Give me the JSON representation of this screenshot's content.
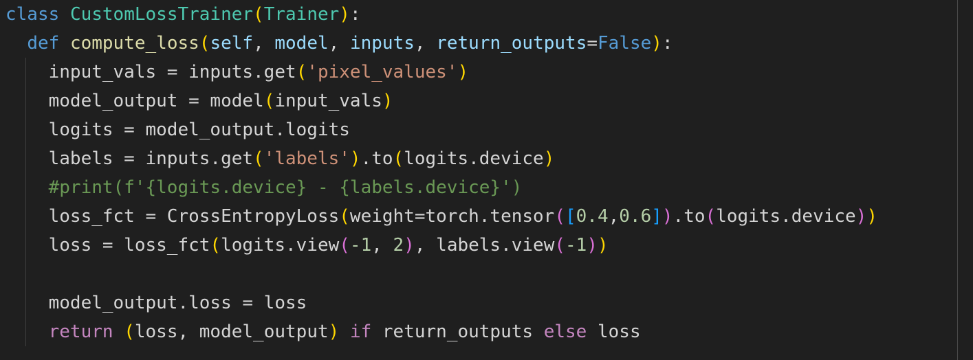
{
  "editor": {
    "lines": [
      [
        {
          "t": "class",
          "c": "kw"
        },
        {
          "t": " ",
          "c": "txt"
        },
        {
          "t": "CustomLossTrainer",
          "c": "cls"
        },
        {
          "t": "(",
          "c": "b1"
        },
        {
          "t": "Trainer",
          "c": "cls"
        },
        {
          "t": ")",
          "c": "b1"
        },
        {
          "t": ":",
          "c": "txt"
        }
      ],
      [
        {
          "t": "  ",
          "c": "txt"
        },
        {
          "t": "def",
          "c": "kw"
        },
        {
          "t": " ",
          "c": "txt"
        },
        {
          "t": "compute_loss",
          "c": "fn"
        },
        {
          "t": "(",
          "c": "b1"
        },
        {
          "t": "self",
          "c": "par"
        },
        {
          "t": ", ",
          "c": "txt"
        },
        {
          "t": "model",
          "c": "par"
        },
        {
          "t": ", ",
          "c": "txt"
        },
        {
          "t": "inputs",
          "c": "par"
        },
        {
          "t": ", ",
          "c": "txt"
        },
        {
          "t": "return_outputs",
          "c": "par"
        },
        {
          "t": "=",
          "c": "txt"
        },
        {
          "t": "False",
          "c": "kw"
        },
        {
          "t": ")",
          "c": "b1"
        },
        {
          "t": ":",
          "c": "txt"
        }
      ],
      [
        {
          "t": "    input_vals = inputs.get",
          "c": "txt"
        },
        {
          "t": "(",
          "c": "b1"
        },
        {
          "t": "'pixel_values'",
          "c": "str"
        },
        {
          "t": ")",
          "c": "b1"
        }
      ],
      [
        {
          "t": "    model_output = model",
          "c": "txt"
        },
        {
          "t": "(",
          "c": "b1"
        },
        {
          "t": "input_vals",
          "c": "txt"
        },
        {
          "t": ")",
          "c": "b1"
        }
      ],
      [
        {
          "t": "    logits = model_output.logits",
          "c": "txt"
        }
      ],
      [
        {
          "t": "    labels = inputs.get",
          "c": "txt"
        },
        {
          "t": "(",
          "c": "b1"
        },
        {
          "t": "'labels'",
          "c": "str"
        },
        {
          "t": ")",
          "c": "b1"
        },
        {
          "t": ".to",
          "c": "txt"
        },
        {
          "t": "(",
          "c": "b1"
        },
        {
          "t": "logits.device",
          "c": "txt"
        },
        {
          "t": ")",
          "c": "b1"
        }
      ],
      [
        {
          "t": "    ",
          "c": "txt"
        },
        {
          "t": "#print(f'{logits.device} - {labels.device}')",
          "c": "cmt"
        }
      ],
      [
        {
          "t": "    loss_fct = CrossEntropyLoss",
          "c": "txt"
        },
        {
          "t": "(",
          "c": "b1"
        },
        {
          "t": "weight=torch.tensor",
          "c": "txt"
        },
        {
          "t": "(",
          "c": "b2"
        },
        {
          "t": "[",
          "c": "b3"
        },
        {
          "t": "0.4",
          "c": "num"
        },
        {
          "t": ",",
          "c": "txt"
        },
        {
          "t": "0.6",
          "c": "num"
        },
        {
          "t": "]",
          "c": "b3"
        },
        {
          "t": ")",
          "c": "b2"
        },
        {
          "t": ".to",
          "c": "txt"
        },
        {
          "t": "(",
          "c": "b2"
        },
        {
          "t": "logits.device",
          "c": "txt"
        },
        {
          "t": ")",
          "c": "b2"
        },
        {
          "t": ")",
          "c": "b1"
        }
      ],
      [
        {
          "t": "    loss = loss_fct",
          "c": "txt"
        },
        {
          "t": "(",
          "c": "b1"
        },
        {
          "t": "logits.view",
          "c": "txt"
        },
        {
          "t": "(",
          "c": "b2"
        },
        {
          "t": "-1",
          "c": "num"
        },
        {
          "t": ", ",
          "c": "txt"
        },
        {
          "t": "2",
          "c": "num"
        },
        {
          "t": ")",
          "c": "b2"
        },
        {
          "t": ", labels.view",
          "c": "txt"
        },
        {
          "t": "(",
          "c": "b2"
        },
        {
          "t": "-1",
          "c": "num"
        },
        {
          "t": ")",
          "c": "b2"
        },
        {
          "t": ")",
          "c": "b1"
        }
      ],
      [],
      [
        {
          "t": "    model_output.loss = loss",
          "c": "txt"
        }
      ],
      [
        {
          "t": "    ",
          "c": "txt"
        },
        {
          "t": "return",
          "c": "ctl"
        },
        {
          "t": " ",
          "c": "txt"
        },
        {
          "t": "(",
          "c": "b1"
        },
        {
          "t": "loss, model_output",
          "c": "txt"
        },
        {
          "t": ")",
          "c": "b1"
        },
        {
          "t": " ",
          "c": "txt"
        },
        {
          "t": "if",
          "c": "ctl"
        },
        {
          "t": " return_outputs ",
          "c": "txt"
        },
        {
          "t": "else",
          "c": "ctl"
        },
        {
          "t": " loss",
          "c": "txt"
        }
      ]
    ]
  }
}
